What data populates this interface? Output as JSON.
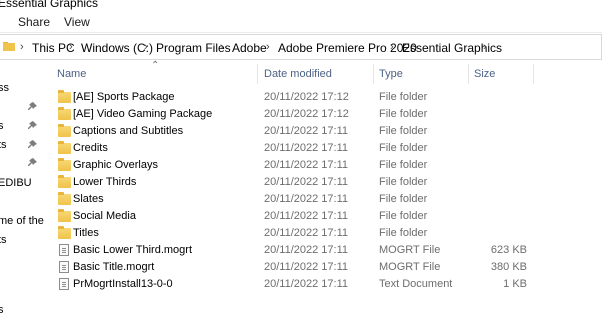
{
  "window": {
    "title": "Essential Graphics"
  },
  "ribbon": {
    "tabs": [
      "Share",
      "View"
    ]
  },
  "address_bar": {
    "breadcrumbs": [
      "This PC",
      "Windows (C:)",
      "Program Files",
      "Adobe",
      "Adobe Premiere Pro 2020",
      "Essential Graphics"
    ]
  },
  "nav_pane": {
    "items": [
      "ss",
      "s",
      "ts",
      "EDIBU",
      "me of the",
      "ts",
      "s"
    ]
  },
  "columns": {
    "name": "Name",
    "date": "Date modified",
    "type": "Type",
    "size": "Size"
  },
  "files": [
    {
      "name": "[AE] Sports Package",
      "date": "20/11/2022 17:12",
      "type": "File folder",
      "size": "",
      "icon": "folder-icon"
    },
    {
      "name": "[AE] Video Gaming Package",
      "date": "20/11/2022 17:12",
      "type": "File folder",
      "size": "",
      "icon": "folder-icon"
    },
    {
      "name": "Captions and Subtitles",
      "date": "20/11/2022 17:11",
      "type": "File folder",
      "size": "",
      "icon": "folder-icon"
    },
    {
      "name": "Credits",
      "date": "20/11/2022 17:11",
      "type": "File folder",
      "size": "",
      "icon": "folder-icon"
    },
    {
      "name": "Graphic Overlays",
      "date": "20/11/2022 17:11",
      "type": "File folder",
      "size": "",
      "icon": "folder-icon"
    },
    {
      "name": "Lower Thirds",
      "date": "20/11/2022 17:11",
      "type": "File folder",
      "size": "",
      "icon": "folder-icon"
    },
    {
      "name": "Slates",
      "date": "20/11/2022 17:11",
      "type": "File folder",
      "size": "",
      "icon": "folder-icon"
    },
    {
      "name": "Social Media",
      "date": "20/11/2022 17:11",
      "type": "File folder",
      "size": "",
      "icon": "folder-icon"
    },
    {
      "name": "Titles",
      "date": "20/11/2022 17:11",
      "type": "File folder",
      "size": "",
      "icon": "folder-icon"
    },
    {
      "name": "Basic Lower Third.mogrt",
      "date": "20/11/2022 17:11",
      "type": "MOGRT File",
      "size": "623 KB",
      "icon": "file-icon"
    },
    {
      "name": "Basic Title.mogrt",
      "date": "20/11/2022 17:11",
      "type": "MOGRT File",
      "size": "380 KB",
      "icon": "file-icon"
    },
    {
      "name": "PrMogrtInstall13-0-0",
      "date": "20/11/2022 17:11",
      "type": "Text Document",
      "size": "1 KB",
      "icon": "file-icon"
    }
  ],
  "colors": {
    "header_text": "#4d6285",
    "secondary_text": "#6d6d6d",
    "folder": "#f0c34a"
  }
}
